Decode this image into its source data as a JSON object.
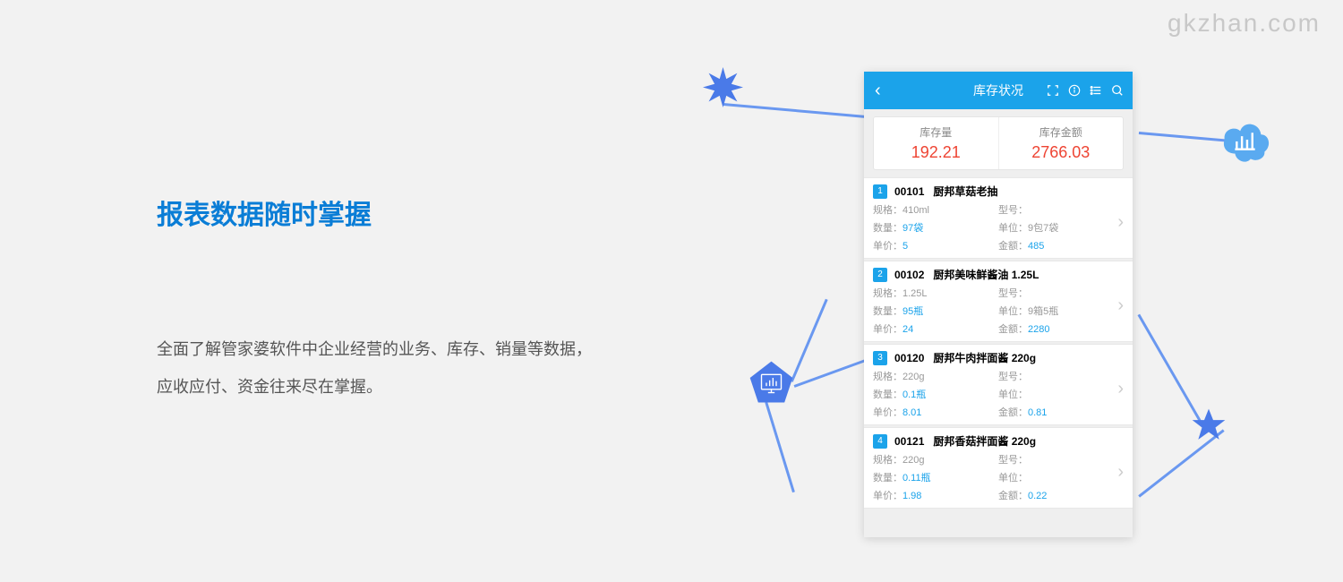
{
  "watermark": "gkzhan.com",
  "heading": "报表数据随时掌握",
  "description": "全面了解管家婆软件中企业经营的业务、库存、销量等数据，应收应付、资金往来尽在掌握。",
  "phone": {
    "title": "库存状况",
    "stats": {
      "qty_label": "库存量",
      "qty_value": "192.21",
      "amt_label": "库存金额",
      "amt_value": "2766.03"
    },
    "labels": {
      "spec": "规格：",
      "model": "型号：",
      "qty": "数量：",
      "unit": "单位：",
      "price": "单价：",
      "amount": "金额："
    },
    "items": [
      {
        "num": "1",
        "code": "00101",
        "name": "厨邦草菇老抽",
        "spec": "410ml",
        "model": "",
        "qty": "97袋",
        "unit": "9包7袋",
        "price": "5",
        "amount": "485"
      },
      {
        "num": "2",
        "code": "00102",
        "name": "厨邦美味鲜酱油 1.25L",
        "spec": "1.25L",
        "model": "",
        "qty": "95瓶",
        "unit": "9箱5瓶",
        "price": "24",
        "amount": "2280"
      },
      {
        "num": "3",
        "code": "00120",
        "name": "厨邦牛肉拌面酱 220g",
        "spec": "220g",
        "model": "",
        "qty": "0.1瓶",
        "unit": "",
        "price": "8.01",
        "amount": "0.81"
      },
      {
        "num": "4",
        "code": "00121",
        "name": "厨邦香菇拌面酱 220g",
        "spec": "220g",
        "model": "",
        "qty": "0.11瓶",
        "unit": "",
        "price": "1.98",
        "amount": "0.22"
      }
    ]
  }
}
